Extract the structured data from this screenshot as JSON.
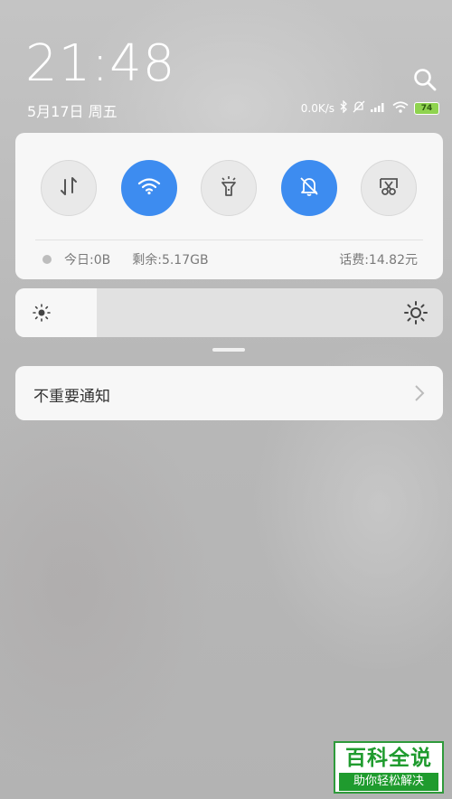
{
  "status_bar": {
    "time": "21:48",
    "date": "5月17日 周五",
    "network_speed": "0.0K/s",
    "battery_level": "74"
  },
  "quick_toggles": [
    {
      "name": "mobile-data",
      "icon": "data-arrows-icon",
      "active": false
    },
    {
      "name": "wifi",
      "icon": "wifi-icon",
      "active": true
    },
    {
      "name": "flashlight",
      "icon": "flashlight-icon",
      "active": false
    },
    {
      "name": "mute",
      "icon": "bell-off-icon",
      "active": true
    },
    {
      "name": "screenshot",
      "icon": "scissors-icon",
      "active": false
    }
  ],
  "data_usage": {
    "today": "今日:0B",
    "remaining": "剩余:5.17GB",
    "balance": "话费:14.82元"
  },
  "brightness": {
    "level_fraction": 0.19
  },
  "notifications": {
    "unimportant_label": "不重要通知"
  },
  "watermark": {
    "title": "百科全说",
    "subtitle": "助你轻松解决"
  },
  "colors": {
    "accent": "#3d8cf0",
    "panel": "#f7f7f7",
    "watermark_green": "#1f9b2e"
  }
}
